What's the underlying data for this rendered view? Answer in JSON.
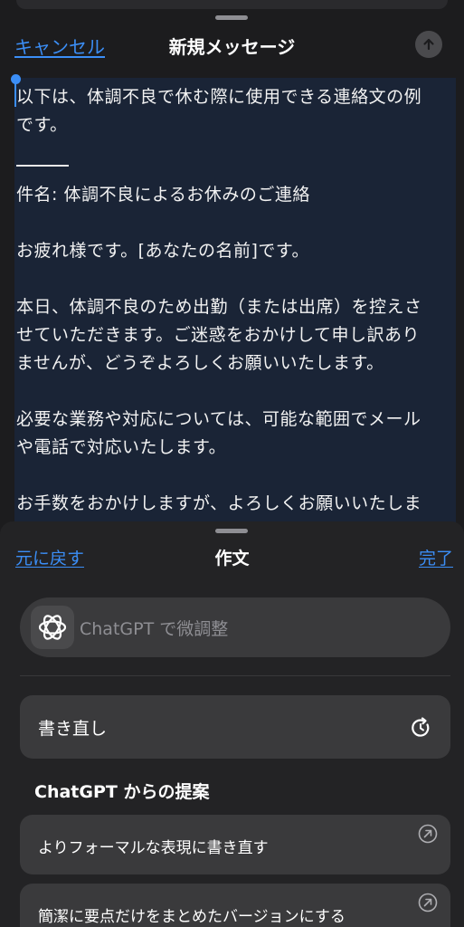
{
  "nav": {
    "cancel_label": "キャンセル",
    "title": "新規メッセージ"
  },
  "message": {
    "lines": [
      "以下は、体調不良で休む際に使用できる連絡文の例",
      "です。",
      "件名: 体調不良によるお休みのご連絡",
      "お疲れ様です。[あなたの名前]です。",
      "本日、体調不良のため出勤（または出席）を控えさ",
      "せていただきます。ご迷惑をおかけして申し訳あり",
      "ませんが、どうぞよろしくお願いいたします。",
      "必要な業務や対応については、可能な範囲でメール",
      "や電話で対応いたします。",
      "お手数をおかけしますが、よろしくお願いいたしま"
    ]
  },
  "compose": {
    "undo_label": "元に戻す",
    "title": "作文",
    "done_label": "完了",
    "input_placeholder": "ChatGPT で微調整",
    "rewrite_label": "書き直し",
    "suggestions_heading": "ChatGPT からの提案",
    "suggestions": [
      "よりフォーマルな表現に書き直す",
      "簡潔に要点だけをまとめたバージョンにする"
    ]
  },
  "icons": {
    "send": "arrow-up-icon",
    "chatgpt": "chatgpt-logo-icon",
    "rewrite": "refresh-icon",
    "suggestion": "arrow-up-right-circle-icon"
  },
  "colors": {
    "accent": "#3b8ef6",
    "selection": "#1a2436",
    "sheet": "#232325",
    "card": "#3a3a3c"
  }
}
